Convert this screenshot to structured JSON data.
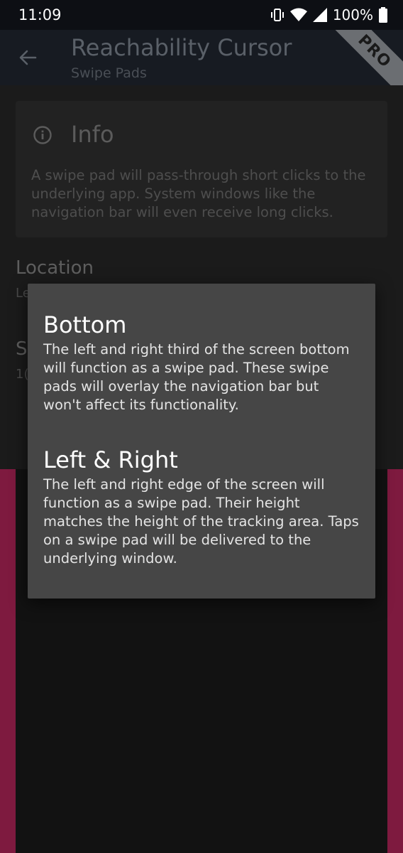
{
  "status_bar": {
    "time": "11:09",
    "battery": "100%",
    "icons": [
      "vibrate-icon",
      "wifi-icon",
      "signal-icon",
      "battery-icon"
    ]
  },
  "app_bar": {
    "title": "Reachability Cursor",
    "subtitle": "Swipe Pads",
    "badge": "PRO"
  },
  "info_card": {
    "heading": "Info",
    "text": "A swipe pad will pass-through short clicks to the underlying app. System windows like the navigation bar will even receive long clicks."
  },
  "settings": {
    "location_label": "Location",
    "location_value": "Le",
    "size_label": "S",
    "size_value": "1("
  },
  "dialog": {
    "sections": [
      {
        "title": "Bottom",
        "text": "The left and right third of the screen bottom will function as a swipe pad. These swipe pads will overlay the navigation bar but won't affect its functionality."
      },
      {
        "title": "Left & Right",
        "text": "The left and right edge of the screen will function as a swipe pad. Their height matches the height of the tracking area. Taps on a swipe pad will be delivered to the underlying window."
      }
    ]
  },
  "colors": {
    "status_bar_bg": "#0d0f14",
    "app_bar_bg": "#171b22",
    "swipe_pad_accent": "#7e1a3f",
    "dialog_bg": "#464646"
  }
}
